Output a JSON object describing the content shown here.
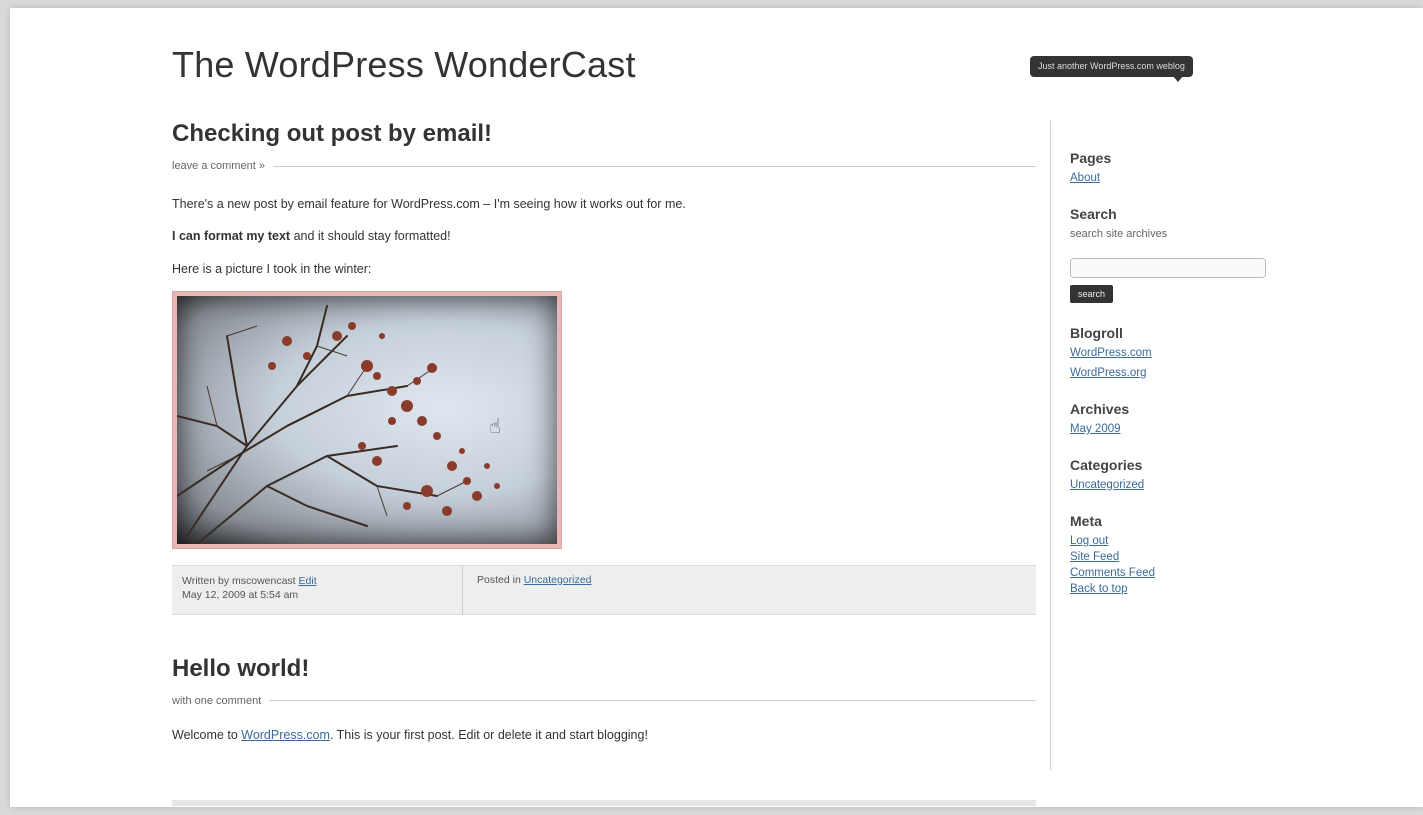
{
  "site": {
    "title": "The WordPress WonderCast",
    "tagline": "Just another WordPress.com weblog"
  },
  "posts": [
    {
      "title": "Checking out post by email!",
      "comment_link": "leave a comment »",
      "paragraphs": [
        "There's a new post by email feature for WordPress.com – I'm seeing how it works out for me.",
        "Here is a picture I took in the winter:"
      ],
      "formatted_bold": "I can format my text",
      "formatted_rest": " and it should stay formatted!",
      "footer": {
        "written_by": "Written by mscowencast",
        "edit": "Edit",
        "date": "May 12, 2009 at 5:54 am",
        "posted_in": "Posted in",
        "category": "Uncategorized"
      }
    },
    {
      "title": "Hello world!",
      "comment_link": "with one comment",
      "body_prefix": "Welcome to ",
      "body_link": "WordPress.com",
      "body_suffix": ". This is your first post. Edit or delete it and start blogging!"
    }
  ],
  "sidebar": {
    "pages": {
      "heading": "Pages",
      "items": [
        "About"
      ]
    },
    "search": {
      "heading": "Search",
      "desc": "search site archives",
      "button": "search"
    },
    "blogroll": {
      "heading": "Blogroll",
      "items": [
        "WordPress.com",
        "WordPress.org"
      ]
    },
    "archives": {
      "heading": "Archives",
      "items": [
        "May 2009"
      ]
    },
    "categories": {
      "heading": "Categories",
      "items": [
        "Uncategorized"
      ]
    },
    "meta": {
      "heading": "Meta",
      "items": [
        "Log out",
        "Site Feed",
        "Comments Feed",
        "Back to top"
      ]
    }
  },
  "colors": {
    "link": "#3a6b9b",
    "tagline_bg": "#333333",
    "photo_frame": "#e9b7b5"
  },
  "icons": {
    "cursor": "hand-cursor-icon"
  }
}
